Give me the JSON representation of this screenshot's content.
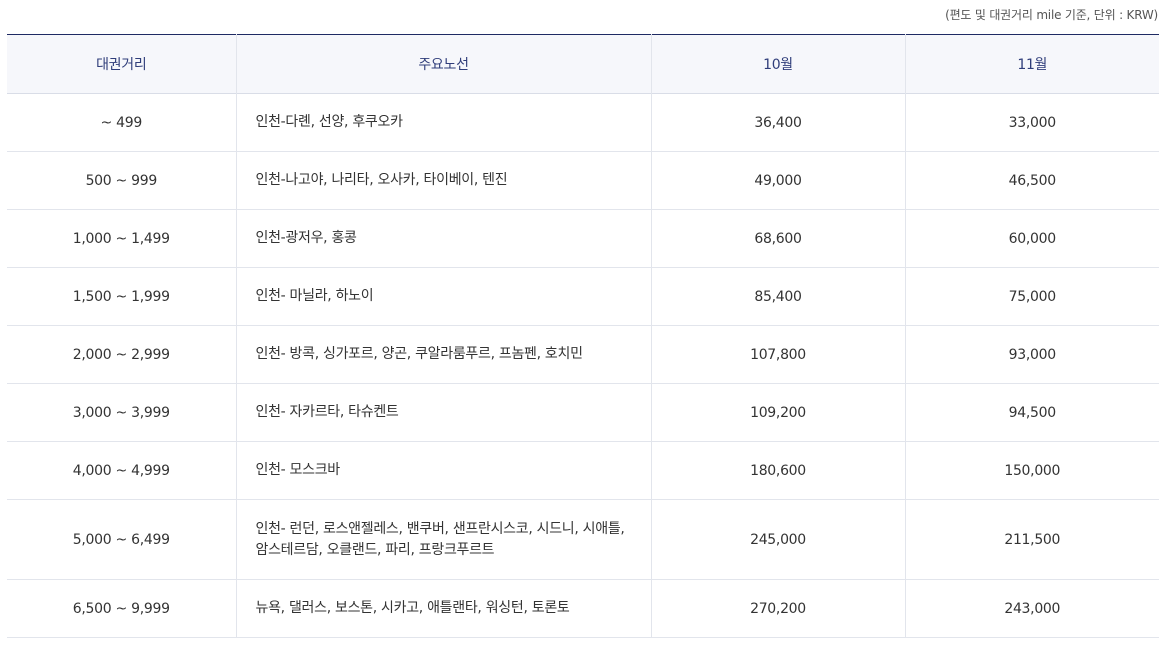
{
  "caption": "(편도 및 대권거리 mile 기준, 단위 : KRW)",
  "headers": {
    "distance": "대권거리",
    "routes": "주요노선",
    "oct": "10월",
    "nov": "11월"
  },
  "rows": [
    {
      "distance": "~ 499",
      "routes": "인천-다롄, 선양, 후쿠오카",
      "oct": "36,400",
      "nov": "33,000"
    },
    {
      "distance": "500 ~ 999",
      "routes": "인천-나고야, 나리타, 오사카, 타이베이, 텐진",
      "oct": "49,000",
      "nov": "46,500"
    },
    {
      "distance": "1,000 ~ 1,499",
      "routes": "인천-광저우, 홍콩",
      "oct": "68,600",
      "nov": "60,000"
    },
    {
      "distance": "1,500 ~ 1,999",
      "routes": "인천- 마닐라, 하노이",
      "oct": "85,400",
      "nov": "75,000"
    },
    {
      "distance": "2,000 ~ 2,999",
      "routes": "인천- 방콕, 싱가포르, 양곤, 쿠알라룸푸르, 프놈펜, 호치민",
      "oct": "107,800",
      "nov": "93,000"
    },
    {
      "distance": "3,000 ~ 3,999",
      "routes": "인천- 자카르타, 타슈켄트",
      "oct": "109,200",
      "nov": "94,500"
    },
    {
      "distance": "4,000 ~ 4,999",
      "routes": "인천- 모스크바",
      "oct": "180,600",
      "nov": "150,000"
    },
    {
      "distance": "5,000 ~ 6,499",
      "routes": "인천- 런던, 로스앤젤레스, 밴쿠버, 샌프란시스코, 시드니, 시애틀, 암스테르담, 오클랜드, 파리, 프랑크푸르트",
      "oct": "245,000",
      "nov": "211,500"
    },
    {
      "distance": "6,500 ~ 9,999",
      "routes": "뉴욕, 댈러스, 보스톤, 시카고, 애틀랜타, 워싱턴, 토론토",
      "oct": "270,200",
      "nov": "243,000"
    }
  ]
}
